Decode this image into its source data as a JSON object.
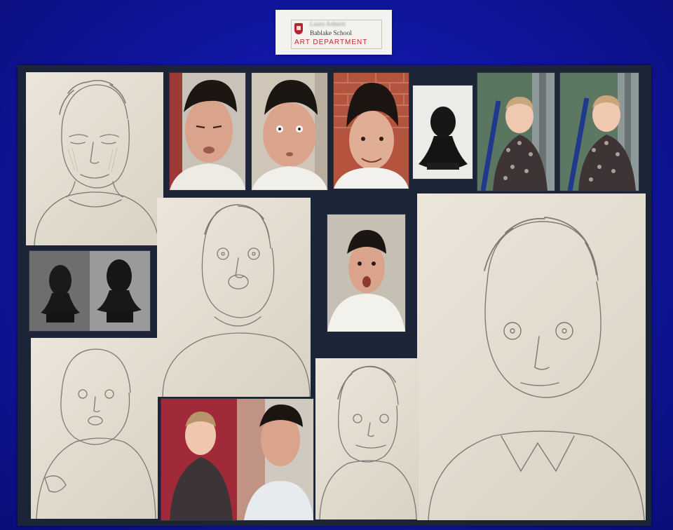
{
  "label": {
    "name_blurred": "Laura Ashurst",
    "school": "Bablake School",
    "department": "ART DEPARTMENT"
  },
  "colors": {
    "wall": "#1217a6",
    "board": "#1c2537",
    "paper": "#e6e0d4",
    "pencil": "#7d7a74",
    "label_red": "#c2262d"
  },
  "icons": {
    "crest": "school-crest-icon"
  }
}
